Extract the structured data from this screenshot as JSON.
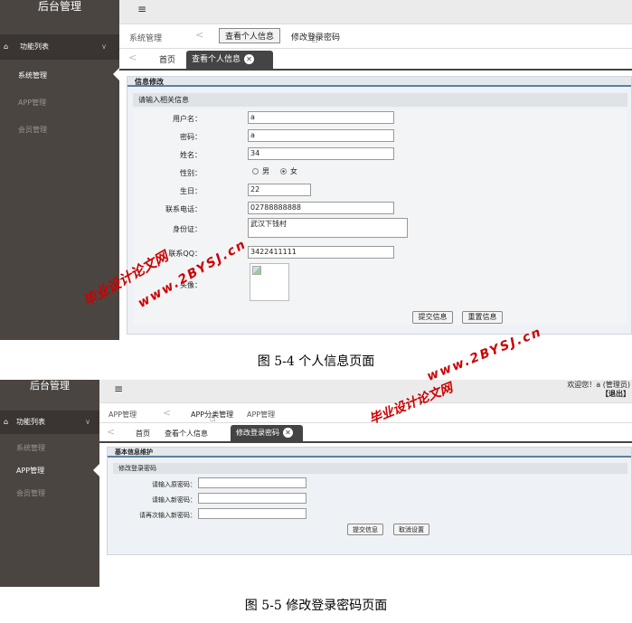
{
  "s1": {
    "logo": "后台管理",
    "sidebar": {
      "header": "功能列表",
      "items": [
        "系统管理",
        "APP管理",
        "会员管理"
      ]
    },
    "topbar": {
      "menu_icon": "≡"
    },
    "breadcrumb": {
      "root": "系统管理",
      "chev": "<",
      "item1": "查看个人信息",
      "item2": "修改登录密码"
    },
    "tabs": {
      "arrow": "<",
      "home": "首页",
      "active": "查看个人信息"
    },
    "panel": {
      "title": "信息修改",
      "subtitle": "请输入相关信息"
    },
    "form": {
      "username_label": "用户名：",
      "username": "a",
      "password_label": "密码：",
      "password": "a",
      "name_label": "姓名：",
      "name": "34",
      "gender_label": "性别：",
      "gender_male": "男",
      "gender_female": "女",
      "age_label": "生日：",
      "age": "22",
      "phone_label": "联系电话：",
      "phone": "02788888888",
      "id_label": "身份证：",
      "id": "武汉下钱村",
      "qq_label": "联系QQ：",
      "qq": "3422411111",
      "avatar_label": "头像："
    },
    "buttons": {
      "submit": "提交信息",
      "reset": "重置信息"
    },
    "caption": "图 5-4 个人信息页面"
  },
  "s2": {
    "logo": "后台管理",
    "sidebar": {
      "header": "功能列表",
      "items": [
        "系统管理",
        "APP管理",
        "会员管理"
      ]
    },
    "topbar": {
      "menu_icon": "≡",
      "welcome": "欢迎您！a (管理员)",
      "logout": "【退出】"
    },
    "breadcrumb": {
      "root": "APP管理",
      "chev": "<",
      "item1": "APP分类管理",
      "item2": "APP管理"
    },
    "tabs": {
      "arrow": "<",
      "home": "首页",
      "tab2": "查看个人信息",
      "active": "修改登录密码"
    },
    "panel": {
      "title": "基本信息维护",
      "subtitle": "修改登录密码"
    },
    "form": {
      "old_label": "请输入原密码：",
      "new_label": "请输入新密码：",
      "confirm_label": "请再次输入新密码："
    },
    "buttons": {
      "submit": "提交信息",
      "cancel": "取消设置"
    },
    "caption": "图 5-5 修改登录密码页面"
  },
  "watermarks": {
    "a": "毕业设计论文网",
    "b": "www.2BYSJ.cn"
  },
  "colors": {
    "sidebar": "#4a4541",
    "tab_active": "#444444",
    "watermark": "#cc0000"
  }
}
